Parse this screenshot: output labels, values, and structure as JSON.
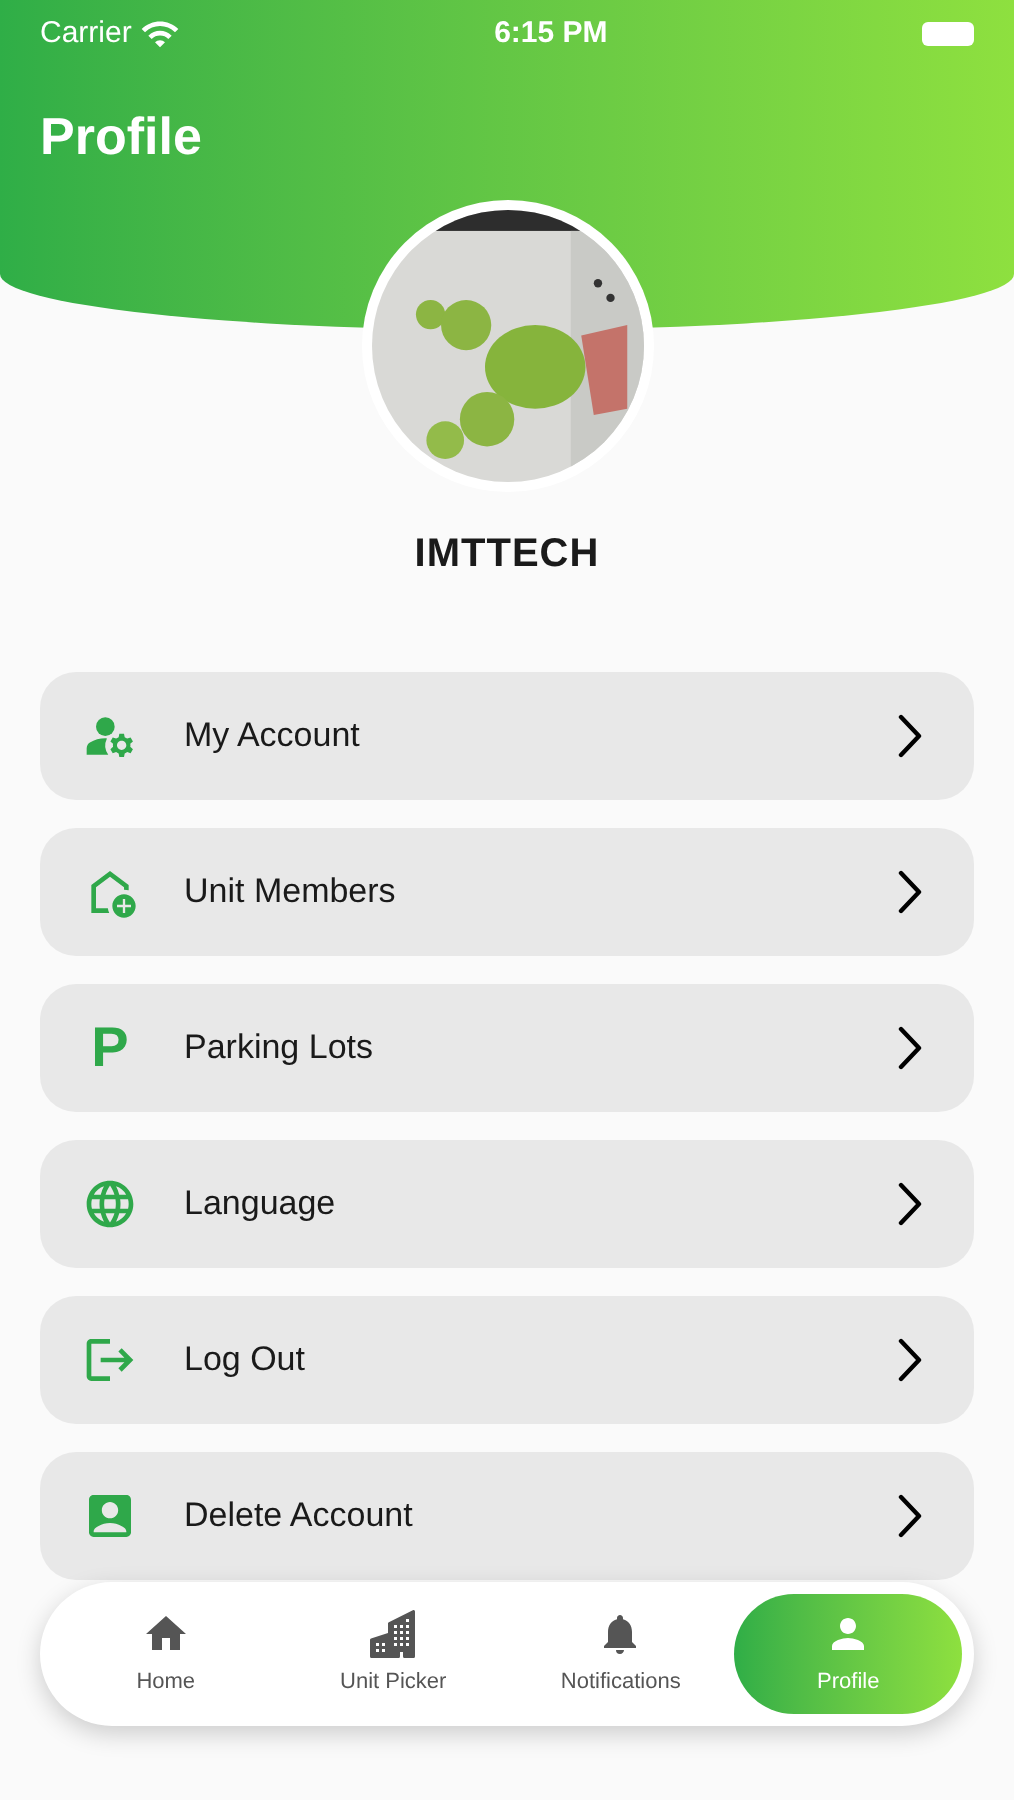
{
  "status_bar": {
    "carrier": "Carrier",
    "time": "6:15 PM"
  },
  "header": {
    "title": "Profile"
  },
  "profile": {
    "name": "IMTTECH"
  },
  "menu": [
    {
      "label": "My Account"
    },
    {
      "label": "Unit Members"
    },
    {
      "label": "Parking Lots",
      "glyph": "P"
    },
    {
      "label": "Language"
    },
    {
      "label": "Log Out"
    },
    {
      "label": "Delete Account"
    }
  ],
  "tab_bar": [
    {
      "label": "Home",
      "selected": false
    },
    {
      "label": "Unit Picker",
      "selected": false
    },
    {
      "label": "Notifications",
      "selected": false
    },
    {
      "label": "Profile",
      "selected": true
    }
  ]
}
